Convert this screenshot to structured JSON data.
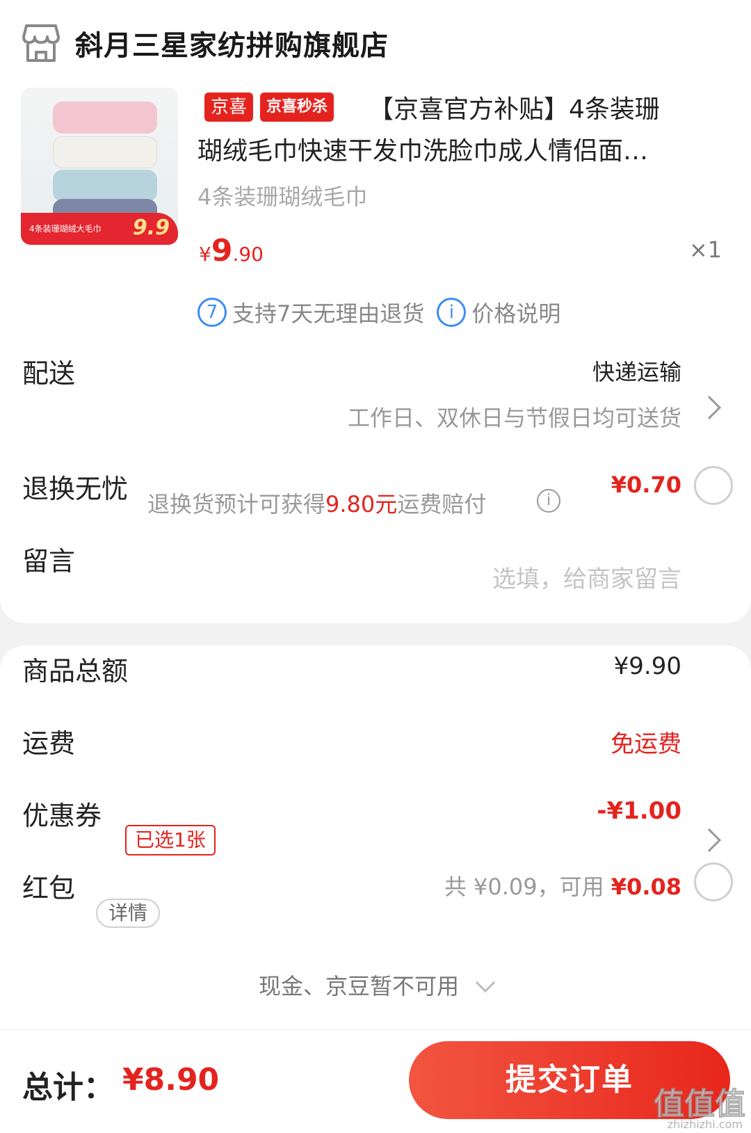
{
  "store": {
    "name": "斜月三星家纺拼购旗舰店"
  },
  "product": {
    "tags": [
      "京喜",
      "京喜秒杀"
    ],
    "title_line1": "【京喜官方补贴】4条装珊",
    "title_line2": "瑚绒毛巾快速干发巾洗脸巾成人情侣面…",
    "spec": "4条装珊瑚绒毛巾",
    "price_symbol": "¥",
    "price_int": "9",
    "price_dec": ".90",
    "quantity": "×1",
    "thumb_price": "9.9",
    "thumb_text": "4条装珊瑚绒大毛巾"
  },
  "services": {
    "return_icon": "7",
    "return_text": "支持7天无理由退货",
    "price_icon": "i",
    "price_text": "价格说明"
  },
  "delivery": {
    "label": "配送",
    "method": "快递运输",
    "note": "工作日、双休日与节假日均可送货"
  },
  "return_worry": {
    "label": "退换无忧",
    "desc_prefix": "退换货预计可获得",
    "desc_amount": "9.80元",
    "desc_suffix": "运费赔付",
    "price": "¥0.70"
  },
  "message": {
    "label": "留言",
    "placeholder": "选填，给商家留言"
  },
  "summary": {
    "goods_label": "商品总额",
    "goods_value": "¥9.90",
    "shipping_label": "运费",
    "shipping_value": "免运费",
    "coupon_label": "优惠券",
    "coupon_badge": "已选1张",
    "coupon_value": "-¥1.00",
    "redpacket_label": "红包",
    "redpacket_badge": "详情",
    "redpacket_total": "共 ¥0.09，可用",
    "redpacket_available": "¥0.08",
    "cash_note": "现金、京豆暂不可用"
  },
  "footer": {
    "total_label": "总计：",
    "total_value": "¥8.90",
    "submit_label": "提交订单"
  },
  "watermark": {
    "text": "值值值",
    "url": "zhizhizhi.com"
  },
  "colors": {
    "accent_red": "#e4231e",
    "info_blue": "#3b8ef0"
  },
  "icons": [
    "store-icon",
    "return-7day-icon",
    "info-icon",
    "chevron-right-icon",
    "chevron-down-icon",
    "radio-icon"
  ]
}
